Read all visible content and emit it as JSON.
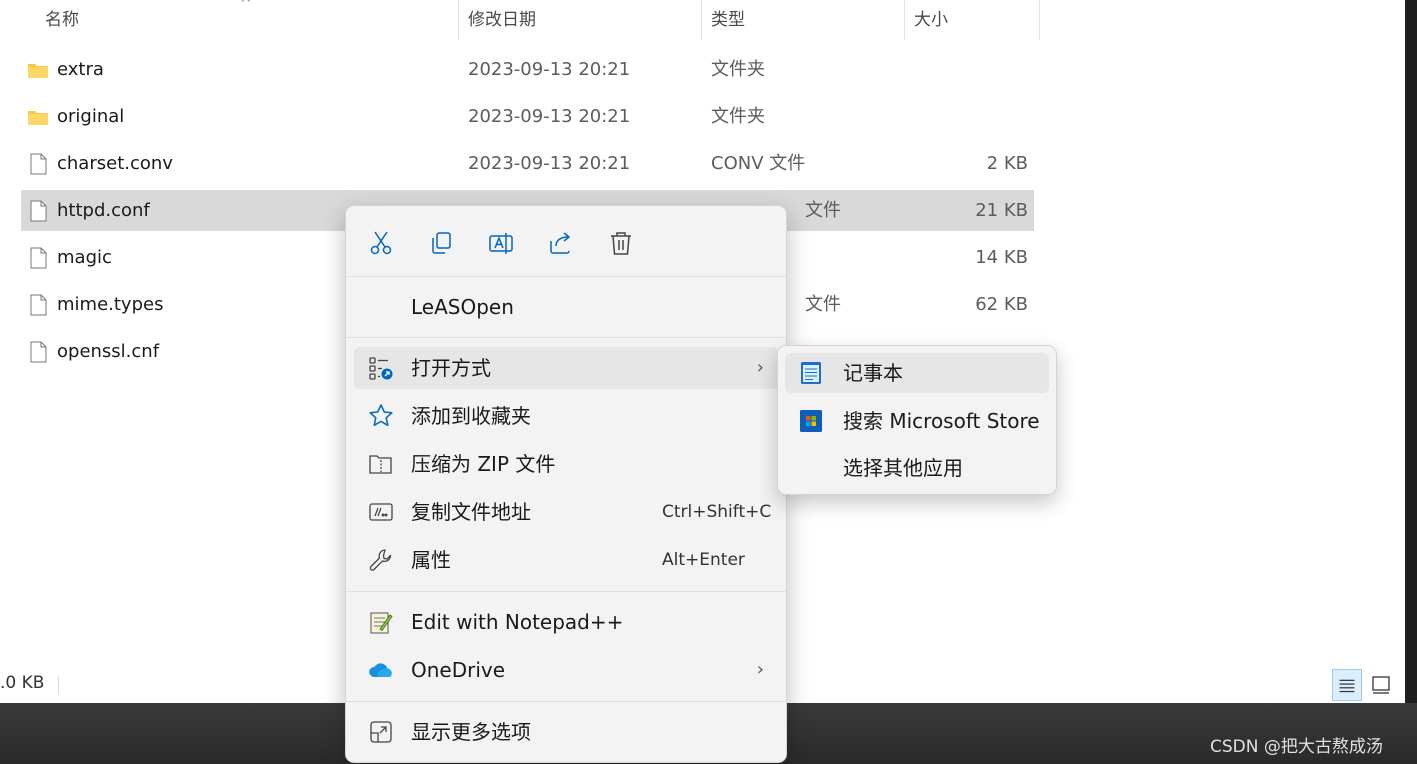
{
  "columns": {
    "name": "名称",
    "date": "修改日期",
    "type": "类型",
    "size": "大小"
  },
  "files": [
    {
      "name": "extra",
      "date": "2023-09-13 20:21",
      "type": "文件夹",
      "size": "",
      "kind": "folder"
    },
    {
      "name": "original",
      "date": "2023-09-13 20:21",
      "type": "文件夹",
      "size": "",
      "kind": "folder"
    },
    {
      "name": "charset.conv",
      "date": "2023-09-13 20:21",
      "type": "CONV 文件",
      "size": "2 KB",
      "kind": "file"
    },
    {
      "name": "httpd.conf",
      "date": "",
      "type": "文件",
      "size": "21 KB",
      "kind": "file",
      "selected": true
    },
    {
      "name": "magic",
      "date": "",
      "type": "",
      "size": "14 KB",
      "kind": "file"
    },
    {
      "name": "mime.types",
      "date": "",
      "type": "文件",
      "size": "62 KB",
      "kind": "file"
    },
    {
      "name": "openssl.cnf",
      "date": "",
      "type": "",
      "size": "",
      "kind": "file"
    }
  ],
  "status": {
    "size_text": ".0 KB"
  },
  "context_menu": {
    "icon_bar": [
      "cut-icon",
      "copy-icon",
      "rename-icon",
      "share-icon",
      "delete-icon"
    ],
    "items": {
      "leasopen": "LeASOpen",
      "open_with": "打开方式",
      "add_favorite": "添加到收藏夹",
      "compress_zip": "压缩为 ZIP 文件",
      "copy_path": "复制文件地址",
      "copy_path_shortcut": "Ctrl+Shift+C",
      "properties": "属性",
      "properties_shortcut": "Alt+Enter",
      "edit_notepadpp": "Edit with Notepad++",
      "onedrive": "OneDrive",
      "show_more": "显示更多选项"
    }
  },
  "submenu": {
    "notepad": "记事本",
    "ms_store": "搜索 Microsoft Store",
    "other_app": "选择其他应用"
  },
  "watermark": "CSDN @把大古熬成汤",
  "colors": {
    "accent": "#0067c0",
    "folder": "#f7c948",
    "selection": "#d9d9d9"
  }
}
